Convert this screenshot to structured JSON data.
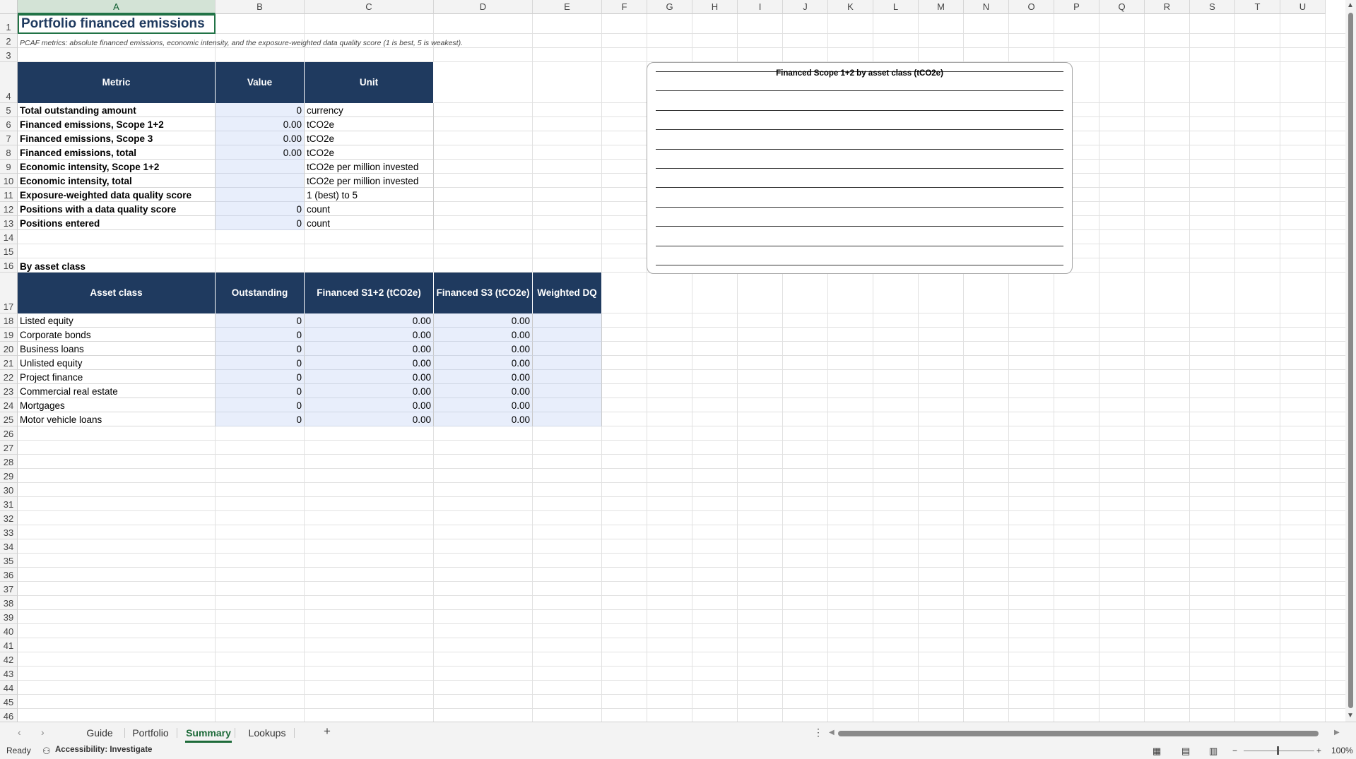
{
  "columns": [
    "A",
    "B",
    "C",
    "D",
    "E",
    "F",
    "G",
    "H",
    "I",
    "J",
    "K",
    "L",
    "M",
    "N",
    "O",
    "P",
    "Q",
    "R",
    "S",
    "T",
    "U"
  ],
  "rows": [
    "1",
    "2",
    "3",
    "4",
    "5",
    "6",
    "7",
    "8",
    "9",
    "10",
    "11",
    "12",
    "13",
    "14",
    "15",
    "16",
    "17",
    "18",
    "19",
    "20",
    "21",
    "22",
    "23",
    "24",
    "25",
    "26",
    "27",
    "28",
    "29",
    "30",
    "31",
    "32",
    "33",
    "34",
    "35",
    "36",
    "37",
    "38",
    "39",
    "40",
    "41",
    "42",
    "43",
    "44",
    "45",
    "46"
  ],
  "sheet": {
    "title": "Portfolio financed emissions",
    "subtitle": "PCAF metrics: absolute financed emissions, economic intensity, and the exposure-weighted data quality score (1 is best, 5 is weakest).",
    "metrics": {
      "headers": [
        "Metric",
        "Value",
        "Unit"
      ],
      "rows": [
        {
          "metric": "Total outstanding amount",
          "value": "0",
          "unit": "currency"
        },
        {
          "metric": "Financed emissions, Scope 1+2",
          "value": "0.00",
          "unit": "tCO2e"
        },
        {
          "metric": "Financed emissions, Scope 3",
          "value": "0.00",
          "unit": "tCO2e"
        },
        {
          "metric": "Financed emissions, total",
          "value": "0.00",
          "unit": "tCO2e"
        },
        {
          "metric": "Economic intensity, Scope 1+2",
          "value": "",
          "unit": "tCO2e per million invested"
        },
        {
          "metric": "Economic intensity, total",
          "value": "",
          "unit": "tCO2e per million invested"
        },
        {
          "metric": "Exposure-weighted data quality score",
          "value": "",
          "unit": "1 (best) to 5"
        },
        {
          "metric": "Positions with a data quality score",
          "value": "0",
          "unit": "count"
        },
        {
          "metric": "Positions entered",
          "value": "0",
          "unit": "count"
        }
      ]
    },
    "section_label": "By asset class",
    "asset_table": {
      "headers": [
        "Asset class",
        "Outstanding",
        "Financed S1+2 (tCO2e)",
        "Financed S3 (tCO2e)",
        "Weighted DQ"
      ],
      "rows": [
        {
          "name": "Listed equity",
          "outstanding": "0",
          "s12": "0.00",
          "s3": "0.00",
          "dq": ""
        },
        {
          "name": "Corporate bonds",
          "outstanding": "0",
          "s12": "0.00",
          "s3": "0.00",
          "dq": ""
        },
        {
          "name": "Business loans",
          "outstanding": "0",
          "s12": "0.00",
          "s3": "0.00",
          "dq": ""
        },
        {
          "name": "Unlisted equity",
          "outstanding": "0",
          "s12": "0.00",
          "s3": "0.00",
          "dq": ""
        },
        {
          "name": "Project finance",
          "outstanding": "0",
          "s12": "0.00",
          "s3": "0.00",
          "dq": ""
        },
        {
          "name": "Commercial real estate",
          "outstanding": "0",
          "s12": "0.00",
          "s3": "0.00",
          "dq": ""
        },
        {
          "name": "Mortgages",
          "outstanding": "0",
          "s12": "0.00",
          "s3": "0.00",
          "dq": ""
        },
        {
          "name": "Motor vehicle loans",
          "outstanding": "0",
          "s12": "0.00",
          "s3": "0.00",
          "dq": ""
        }
      ]
    },
    "chart": {
      "title": "Financed Scope 1+2 by asset class (tCO2e)",
      "gridline_count": 11
    }
  },
  "tabs": [
    {
      "label": "Guide",
      "active": false
    },
    {
      "label": "Portfolio",
      "active": false
    },
    {
      "label": "Summary",
      "active": true
    },
    {
      "label": "Lookups",
      "active": false
    }
  ],
  "status": {
    "ready": "Ready",
    "accessibility": "Accessibility: Investigate",
    "zoom": "100%"
  },
  "icons": {
    "prev_sheet": "chevron-left-icon",
    "next_sheet": "chevron-right-icon",
    "add_sheet": "plus-icon",
    "more": "more-vertical-icon"
  },
  "colors": {
    "header_fill": "#1f3a5f",
    "value_fill": "#e8eefb",
    "accent": "#217346"
  }
}
